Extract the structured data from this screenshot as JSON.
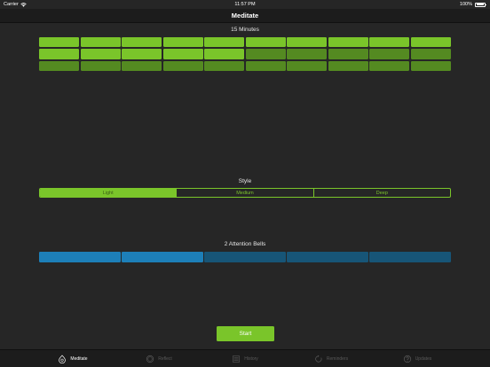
{
  "status_bar": {
    "carrier": "Carrier",
    "time": "11:57 PM",
    "battery": "100%"
  },
  "nav": {
    "title": "Meditate"
  },
  "duration": {
    "label": "15 Minutes",
    "rows": [
      [
        true,
        true,
        true,
        true,
        true,
        true,
        true,
        true,
        true,
        true
      ],
      [
        true,
        true,
        true,
        true,
        true,
        false,
        false,
        false,
        false,
        false
      ],
      [
        false,
        false,
        false,
        false,
        false,
        false,
        false,
        false,
        false,
        false
      ]
    ],
    "selected_minutes": 15,
    "on_color": "#7ac52a",
    "off_color": "#548a21"
  },
  "style": {
    "label": "Style",
    "options": [
      "Light",
      "Medium",
      "Deep"
    ],
    "selected": "Light"
  },
  "bells": {
    "label": "2 Attention Bells",
    "count_total": 5,
    "selected_count": 2,
    "on_color": "#1d7fb8",
    "off_color": "#175577"
  },
  "start": {
    "label": "Start"
  },
  "tabs": [
    {
      "label": "Meditate",
      "icon": "meditate-icon",
      "active": true
    },
    {
      "label": "Reflect",
      "icon": "reflect-icon",
      "active": false
    },
    {
      "label": "History",
      "icon": "history-icon",
      "active": false
    },
    {
      "label": "Reminders",
      "icon": "reminders-icon",
      "active": false
    },
    {
      "label": "Updates",
      "icon": "updates-icon",
      "active": false
    }
  ]
}
